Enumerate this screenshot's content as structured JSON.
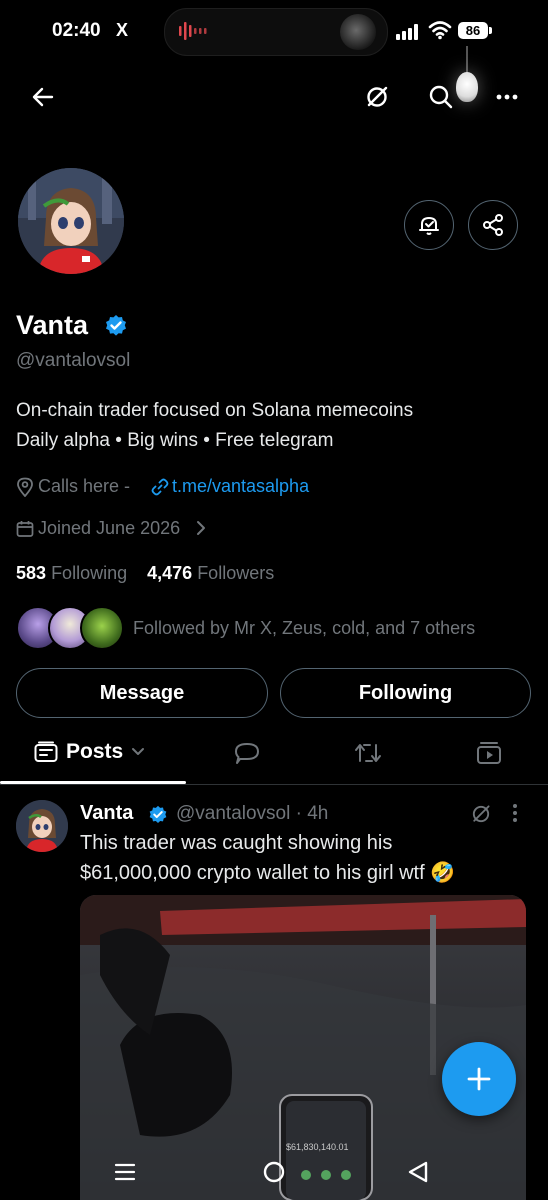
{
  "status_bar": {
    "time": "02:40",
    "x_icon": "X",
    "battery": "86"
  },
  "profile": {
    "name": "Vanta",
    "handle": "@vantalovsol",
    "bio_line1": "On-chain trader focused on Solana memecoins",
    "bio_line2": "Daily alpha • Big wins • Free telegram",
    "location": "Calls here -",
    "link": "t.me/vantasalpha",
    "joined": "Joined June 2026",
    "following_count": "583",
    "following_label": "Following",
    "followers_count": "4,476",
    "followers_label": "Followers",
    "followed_by": "Followed by Mr X, Zeus, cold, and 7 others"
  },
  "actions": {
    "message_label": "Message",
    "following_label": "Following"
  },
  "tabs": {
    "posts_label": "Posts"
  },
  "tweet": {
    "name": "Vanta",
    "handle_time": "@vantalovsol · 4h",
    "text_line1": "This trader was caught showing his",
    "text_line2": "$61,000,000 crypto wallet to his girl wtf 🤣",
    "media_phone_text": "$61,830,140.01"
  },
  "colors": {
    "accent": "#1d9bf0",
    "muted": "#71767b",
    "background": "#000000"
  },
  "icons": [
    "back-arrow-icon",
    "grok-icon",
    "search-icon",
    "more-icon",
    "notify-bell-icon",
    "share-icon",
    "verified-badge-icon",
    "location-icon",
    "link-icon",
    "calendar-icon",
    "chevron-right-icon",
    "posts-icon",
    "chevron-down-icon",
    "replies-icon",
    "highlights-icon",
    "media-icon",
    "plus-icon",
    "menu-icon",
    "home-circle-icon",
    "back-triangle-icon"
  ]
}
